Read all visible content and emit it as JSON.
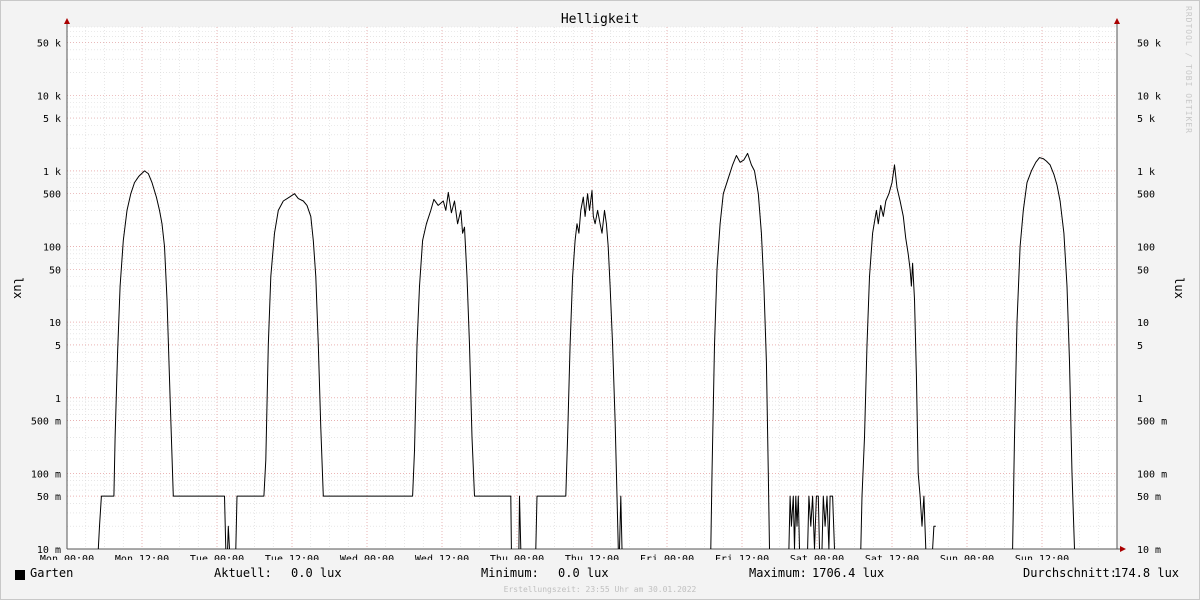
{
  "chart_data": {
    "type": "line",
    "title": "Helligkeit",
    "ylabel": "lux",
    "y_scale": "log",
    "ylim": [
      0.01,
      80000
    ],
    "y_ticks": [
      {
        "v": 0.01,
        "label": "10 m"
      },
      {
        "v": 0.05,
        "label": "50 m"
      },
      {
        "v": 0.1,
        "label": "100 m"
      },
      {
        "v": 0.5,
        "label": "500 m"
      },
      {
        "v": 1,
        "label": "1"
      },
      {
        "v": 5,
        "label": "5"
      },
      {
        "v": 10,
        "label": "10"
      },
      {
        "v": 50,
        "label": "50"
      },
      {
        "v": 100,
        "label": "100"
      },
      {
        "v": 500,
        "label": "500"
      },
      {
        "v": 1000,
        "label": "1 k"
      },
      {
        "v": 5000,
        "label": "5 k"
      },
      {
        "v": 10000,
        "label": "10 k"
      },
      {
        "v": 50000,
        "label": "50 k"
      }
    ],
    "x_unit": "hours since Mon 00:00",
    "xlim": [
      0,
      168
    ],
    "x_ticks": [
      {
        "h": 0,
        "label": "Mon 00:00"
      },
      {
        "h": 12,
        "label": "Mon 12:00"
      },
      {
        "h": 24,
        "label": "Tue 00:00"
      },
      {
        "h": 36,
        "label": "Tue 12:00"
      },
      {
        "h": 48,
        "label": "Wed 00:00"
      },
      {
        "h": 60,
        "label": "Wed 12:00"
      },
      {
        "h": 72,
        "label": "Thu 00:00"
      },
      {
        "h": 84,
        "label": "Thu 12:00"
      },
      {
        "h": 96,
        "label": "Fri 00:00"
      },
      {
        "h": 108,
        "label": "Fri 12:00"
      },
      {
        "h": 120,
        "label": "Sat 00:00"
      },
      {
        "h": 132,
        "label": "Sat 12:00"
      },
      {
        "h": 144,
        "label": "Sun 00:00"
      },
      {
        "h": 156,
        "label": "Sun 12:00"
      }
    ],
    "grid": true,
    "series": [
      {
        "name": "Garten",
        "color": "#000000",
        "segments": [
          [
            [
              5.0,
              0.01
            ],
            [
              5.2,
              0.02
            ],
            [
              5.5,
              0.05
            ],
            [
              7.5,
              0.05
            ],
            [
              7.7,
              0.3
            ],
            [
              8.1,
              4
            ],
            [
              8.5,
              30
            ],
            [
              9.0,
              120
            ],
            [
              9.6,
              300
            ],
            [
              10.2,
              500
            ],
            [
              10.8,
              700
            ],
            [
              11.5,
              850
            ],
            [
              12.4,
              1000
            ],
            [
              13.0,
              920
            ],
            [
              13.6,
              700
            ],
            [
              14.3,
              450
            ],
            [
              14.8,
              300
            ],
            [
              15.2,
              200
            ],
            [
              15.6,
              100
            ],
            [
              16.0,
              20
            ],
            [
              16.5,
              1
            ],
            [
              17.0,
              0.05
            ],
            [
              25.2,
              0.05
            ],
            [
              25.4,
              0.01
            ]
          ],
          [
            [
              25.7,
              0.01
            ],
            [
              25.8,
              0.02
            ],
            [
              26.0,
              0.01
            ]
          ],
          [
            [
              27.0,
              0.01
            ],
            [
              27.2,
              0.05
            ],
            [
              31.5,
              0.05
            ],
            [
              31.8,
              0.15
            ],
            [
              32.2,
              5
            ],
            [
              32.6,
              40
            ],
            [
              33.2,
              150
            ],
            [
              33.8,
              300
            ],
            [
              34.6,
              400
            ],
            [
              35.6,
              450
            ],
            [
              36.4,
              500
            ],
            [
              37.0,
              430
            ],
            [
              37.8,
              400
            ],
            [
              38.4,
              350
            ],
            [
              39.0,
              250
            ],
            [
              39.4,
              120
            ],
            [
              39.8,
              40
            ],
            [
              40.2,
              5
            ],
            [
              40.6,
              0.4
            ],
            [
              41.0,
              0.05
            ],
            [
              55.3,
              0.05
            ],
            [
              55.6,
              0.2
            ],
            [
              56.0,
              5
            ],
            [
              56.4,
              30
            ],
            [
              56.9,
              120
            ],
            [
              57.5,
              200
            ],
            [
              58.2,
              300
            ],
            [
              58.7,
              420
            ],
            [
              59.4,
              350
            ],
            [
              60.2,
              400
            ],
            [
              60.6,
              300
            ],
            [
              61.0,
              520
            ],
            [
              61.5,
              280
            ],
            [
              62.0,
              400
            ],
            [
              62.5,
              200
            ],
            [
              63.0,
              300
            ],
            [
              63.3,
              150
            ],
            [
              63.6,
              180
            ],
            [
              64.0,
              40
            ],
            [
              64.4,
              5
            ],
            [
              64.8,
              0.3
            ],
            [
              65.2,
              0.05
            ],
            [
              71.0,
              0.05
            ],
            [
              71.1,
              0.01
            ]
          ],
          [
            [
              72.3,
              0.01
            ],
            [
              72.4,
              0.05
            ],
            [
              72.6,
              0.01
            ]
          ],
          [
            [
              75.0,
              0.01
            ],
            [
              75.2,
              0.05
            ],
            [
              79.8,
              0.05
            ],
            [
              80.1,
              0.3
            ],
            [
              80.5,
              5
            ],
            [
              80.9,
              40
            ],
            [
              81.3,
              120
            ],
            [
              81.6,
              200
            ],
            [
              81.9,
              150
            ],
            [
              82.2,
              300
            ],
            [
              82.6,
              450
            ],
            [
              82.9,
              250
            ],
            [
              83.3,
              500
            ],
            [
              83.6,
              300
            ],
            [
              84.0,
              550
            ],
            [
              84.2,
              250
            ],
            [
              84.5,
              200
            ],
            [
              84.9,
              300
            ],
            [
              85.3,
              200
            ],
            [
              85.6,
              150
            ],
            [
              86.0,
              300
            ],
            [
              86.3,
              200
            ],
            [
              86.6,
              100
            ],
            [
              86.9,
              30
            ],
            [
              87.3,
              5
            ],
            [
              87.7,
              0.5
            ],
            [
              88.0,
              0.05
            ],
            [
              88.2,
              0.01
            ]
          ],
          [
            [
              88.4,
              0.01
            ],
            [
              88.6,
              0.05
            ],
            [
              88.8,
              0.01
            ]
          ],
          [
            [
              103.0,
              0.01
            ],
            [
              103.2,
              0.1
            ],
            [
              103.6,
              5
            ],
            [
              104.0,
              50
            ],
            [
              104.5,
              200
            ],
            [
              105.0,
              500
            ],
            [
              105.8,
              800
            ],
            [
              106.5,
              1200
            ],
            [
              107.1,
              1600
            ],
            [
              107.7,
              1300
            ],
            [
              108.3,
              1400
            ],
            [
              108.9,
              1706
            ],
            [
              109.5,
              1200
            ],
            [
              110.0,
              1000
            ],
            [
              110.6,
              500
            ],
            [
              111.1,
              150
            ],
            [
              111.5,
              30
            ],
            [
              111.9,
              3
            ],
            [
              112.2,
              0.1
            ],
            [
              112.4,
              0.01
            ]
          ],
          [
            [
              115.5,
              0.01
            ],
            [
              115.7,
              0.05
            ],
            [
              115.9,
              0.02
            ],
            [
              116.2,
              0.05
            ],
            [
              116.4,
              0.01
            ],
            [
              116.6,
              0.05
            ],
            [
              116.8,
              0.02
            ],
            [
              117.0,
              0.05
            ],
            [
              117.2,
              0.01
            ]
          ],
          [
            [
              118.5,
              0.01
            ],
            [
              118.7,
              0.05
            ],
            [
              119.0,
              0.02
            ],
            [
              119.3,
              0.05
            ],
            [
              119.6,
              0.01
            ],
            [
              119.9,
              0.05
            ],
            [
              120.2,
              0.05
            ],
            [
              120.4,
              0.01
            ]
          ],
          [
            [
              120.8,
              0.01
            ],
            [
              121.0,
              0.05
            ],
            [
              121.3,
              0.02
            ],
            [
              121.6,
              0.05
            ],
            [
              121.9,
              0.01
            ],
            [
              122.1,
              0.05
            ],
            [
              122.5,
              0.05
            ],
            [
              122.8,
              0.01
            ]
          ],
          [
            [
              127.0,
              0.01
            ],
            [
              127.2,
              0.05
            ],
            [
              127.6,
              0.3
            ],
            [
              128.0,
              5
            ],
            [
              128.4,
              40
            ],
            [
              128.9,
              150
            ],
            [
              129.5,
              300
            ],
            [
              129.8,
              200
            ],
            [
              130.2,
              350
            ],
            [
              130.6,
              250
            ],
            [
              131.0,
              400
            ],
            [
              131.5,
              500
            ],
            [
              132.0,
              700
            ],
            [
              132.4,
              1200
            ],
            [
              132.8,
              600
            ],
            [
              133.3,
              400
            ],
            [
              133.8,
              250
            ],
            [
              134.2,
              130
            ],
            [
              134.6,
              80
            ],
            [
              134.9,
              50
            ],
            [
              135.1,
              30
            ],
            [
              135.3,
              60
            ],
            [
              135.6,
              20
            ],
            [
              135.9,
              2
            ],
            [
              136.2,
              0.1
            ],
            [
              136.5,
              0.05
            ],
            [
              136.8,
              0.02
            ],
            [
              137.1,
              0.05
            ],
            [
              137.4,
              0.01
            ]
          ],
          [
            [
              138.5,
              0.01
            ],
            [
              138.7,
              0.02
            ],
            [
              139.0,
              0.02
            ]
          ],
          [
            [
              151.3,
              0.01
            ],
            [
              151.6,
              0.3
            ],
            [
              152.0,
              10
            ],
            [
              152.5,
              100
            ],
            [
              153.0,
              300
            ],
            [
              153.6,
              700
            ],
            [
              154.3,
              1000
            ],
            [
              155.0,
              1300
            ],
            [
              155.6,
              1500
            ],
            [
              156.2,
              1450
            ],
            [
              156.7,
              1350
            ],
            [
              157.3,
              1200
            ],
            [
              157.9,
              900
            ],
            [
              158.4,
              650
            ],
            [
              158.9,
              400
            ],
            [
              159.5,
              150
            ],
            [
              160.0,
              30
            ],
            [
              160.4,
              3
            ],
            [
              160.8,
              0.1
            ],
            [
              161.2,
              0.01
            ]
          ]
        ]
      }
    ]
  },
  "legend": {
    "series_name": "Garten",
    "current_label": "Aktuell:",
    "current_value": "0.0 lux",
    "min_label": "Minimum:",
    "min_value": "0.0 lux",
    "max_label": "Maximum:",
    "max_value": "1706.4 lux",
    "avg_label": "Durchschnitt:",
    "avg_value": "174.8 lux"
  },
  "footer": "Erstellungszeit: 23:55 Uhr am 30.01.2022",
  "watermark": "RRDTOOL / TOBI OETIKER",
  "colors": {
    "background": "#f3f3f3",
    "plot_background": "#ffffff",
    "major_grid": "#e8a0a0",
    "minor_grid": "#d8d8d8",
    "line": "#000000",
    "axis_arrow": "#aa0000"
  }
}
